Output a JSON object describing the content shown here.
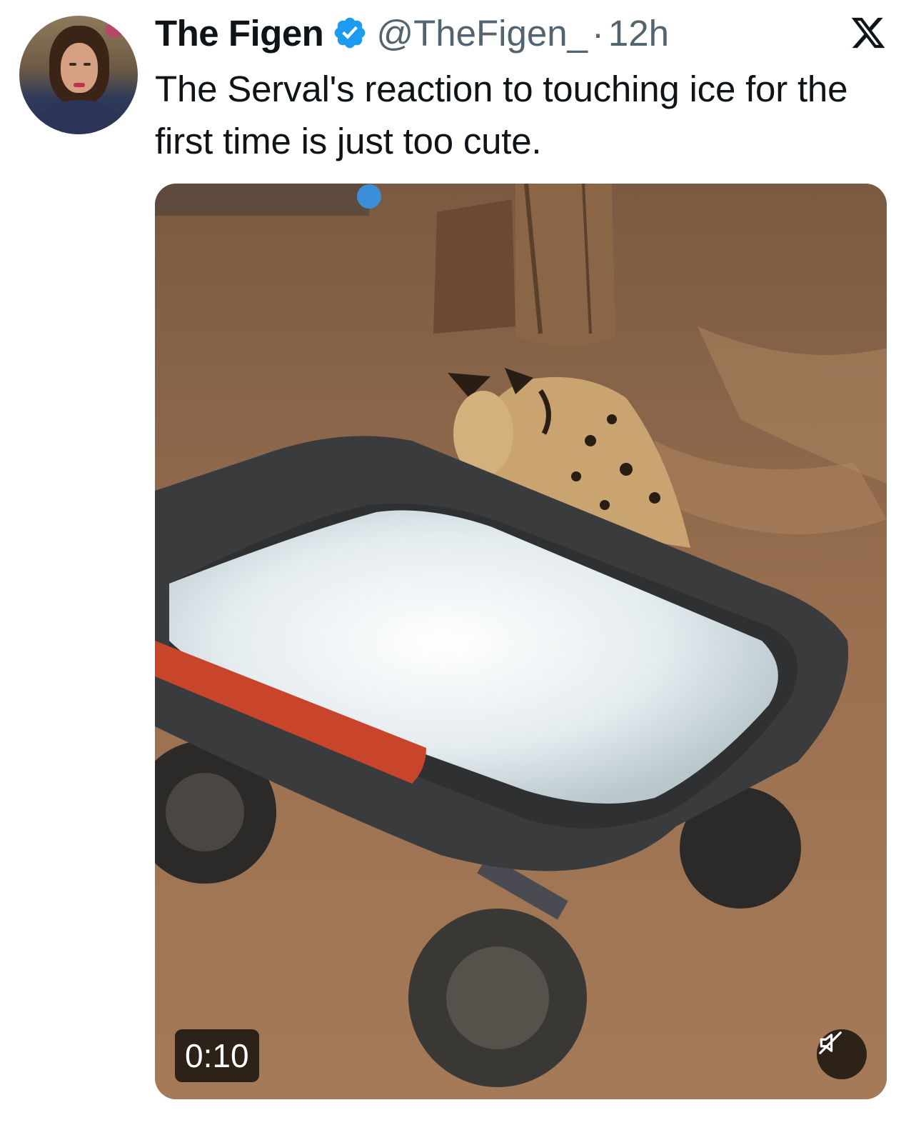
{
  "author": {
    "name": "The Figen",
    "handle": "@TheFigen_",
    "separator": "·",
    "time": "12h",
    "verified_color": "#1d9bf0"
  },
  "tweet": {
    "text": "The Serval's reaction to touching ice for the first time is just too cute."
  },
  "media": {
    "type": "video",
    "duration": "0:10",
    "muted": true
  },
  "icons": {
    "platform_logo": "x-logo-icon",
    "verified": "verified-badge-icon",
    "mute": "speaker-muted-icon"
  },
  "colors": {
    "text_primary": "#0f1419",
    "text_secondary": "#536471",
    "accent": "#1d9bf0"
  }
}
